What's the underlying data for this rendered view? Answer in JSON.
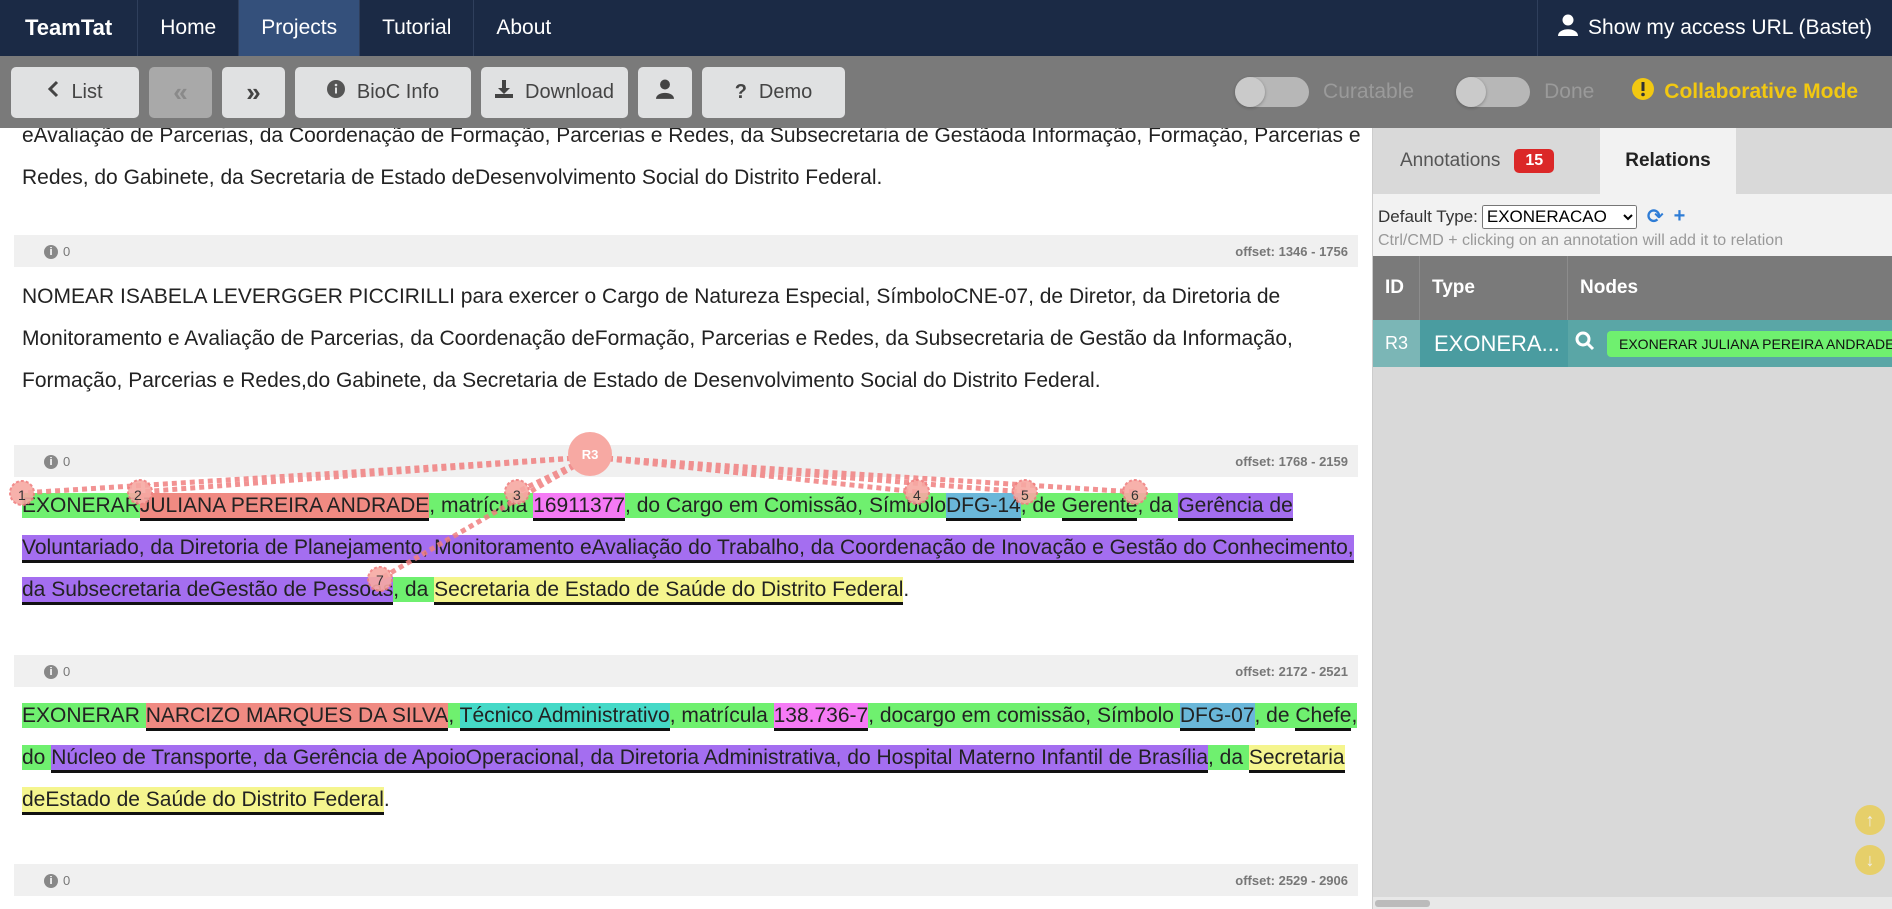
{
  "nav": {
    "brand": "TeamTat",
    "items": [
      "Home",
      "Projects",
      "Tutorial",
      "About"
    ],
    "active": "Projects",
    "access_url": "Show my access URL (Bastet)"
  },
  "toolbar": {
    "list": "List",
    "prev": "«",
    "next": "»",
    "bioc_info": "BioC Info",
    "download": "Download",
    "demo": "Demo",
    "curatable": "Curatable",
    "done": "Done",
    "collab": "Collaborative Mode"
  },
  "doc": {
    "p0_line1": "eAvaliação de Parcerias, da Coordenação de Formação, Parcerias e Redes, da Subsecretaria de Gestãoda Informação, Formação, Parcerias e",
    "p0_line2": "Redes, do Gabinete, da Secretaria de Estado deDesenvolvimento Social do Distrito Federal.",
    "meta1": {
      "count": "0",
      "offset": "offset: 1346 - 1756"
    },
    "p1": "NOMEAR ISABELA LEVERGGER PICCIRILLI para exercer o Cargo de Natureza Especial, SímboloCNE-07, de Diretor, da Diretoria de Monitoramento e Avaliação de Parcerias, da Coordenação deFormação, Parcerias e Redes, da Subsecretaria de Gestão da Informação, Formação, Parcerias e Redes,do Gabinete, da Secretaria de Estado de Desenvolvimento Social do Distrito Federal.",
    "meta2": {
      "count": "0",
      "offset": "offset: 1768 - 2159"
    },
    "p2": {
      "s1": "EXONERAR",
      "s2": "JULIANA PEREIRA ANDRADE",
      "s3": ", matrícula ",
      "s4": "16911377",
      "s5": ", do Cargo em Comissão, Símbolo",
      "s6": "DFG-14",
      "s7": ", de ",
      "s8": "Gerente",
      "s9": ", da ",
      "s10": "Gerência de Voluntariado, da Diretoria de Planejamento, Monitoramento eAvaliação do Trabalho, da Coordenação de Inovação e Gestão do Conhecimento, da Subsecretaria deGestão de Pessoas",
      "s11": ", da ",
      "s12": "Secretaria de Estado de Saúde do Distrito Federal",
      "s13": "."
    },
    "relation": {
      "label": "R3",
      "nodes": [
        "1",
        "2",
        "3",
        "4",
        "5",
        "6",
        "7"
      ]
    },
    "meta3": {
      "count": "0",
      "offset": "offset: 2172 - 2521"
    },
    "p3": {
      "s1": "EXONERAR ",
      "s2": "NARCIZO MARQUES DA SILVA",
      "s3": ", ",
      "s4": "Técnico Administrativo",
      "s5": ", matrícula ",
      "s6": "138.736-7",
      "s7": ", docargo em comissão, Símbolo ",
      "s8": "DFG-07",
      "s9": ", de ",
      "s10": "Chefe",
      "s11": ", do ",
      "s12": "Núcleo de Transporte, da Gerência de ApoioOperacional, da Diretoria Administrativa, do Hospital Materno Infantil de Brasília",
      "s13": ", da ",
      "s14": "Secretaria deEstado de Saúde do Distrito Federal",
      "s15": "."
    },
    "meta4": {
      "count": "0",
      "offset": "offset: 2529 - 2906"
    }
  },
  "panel": {
    "tab_annotations": "Annotations",
    "annotations_count": "15",
    "tab_relations": "Relations",
    "default_type_label": "Default Type:",
    "default_type_value": "EXONERACAO",
    "hint": "Ctrl/CMD + clicking on an annotation will add it to relation",
    "columns": [
      "ID",
      "Type",
      "Nodes"
    ],
    "row": {
      "id": "R3",
      "type": "EXONERA...",
      "node": "EXONERAR JULIANA PEREIRA ANDRADE"
    }
  }
}
